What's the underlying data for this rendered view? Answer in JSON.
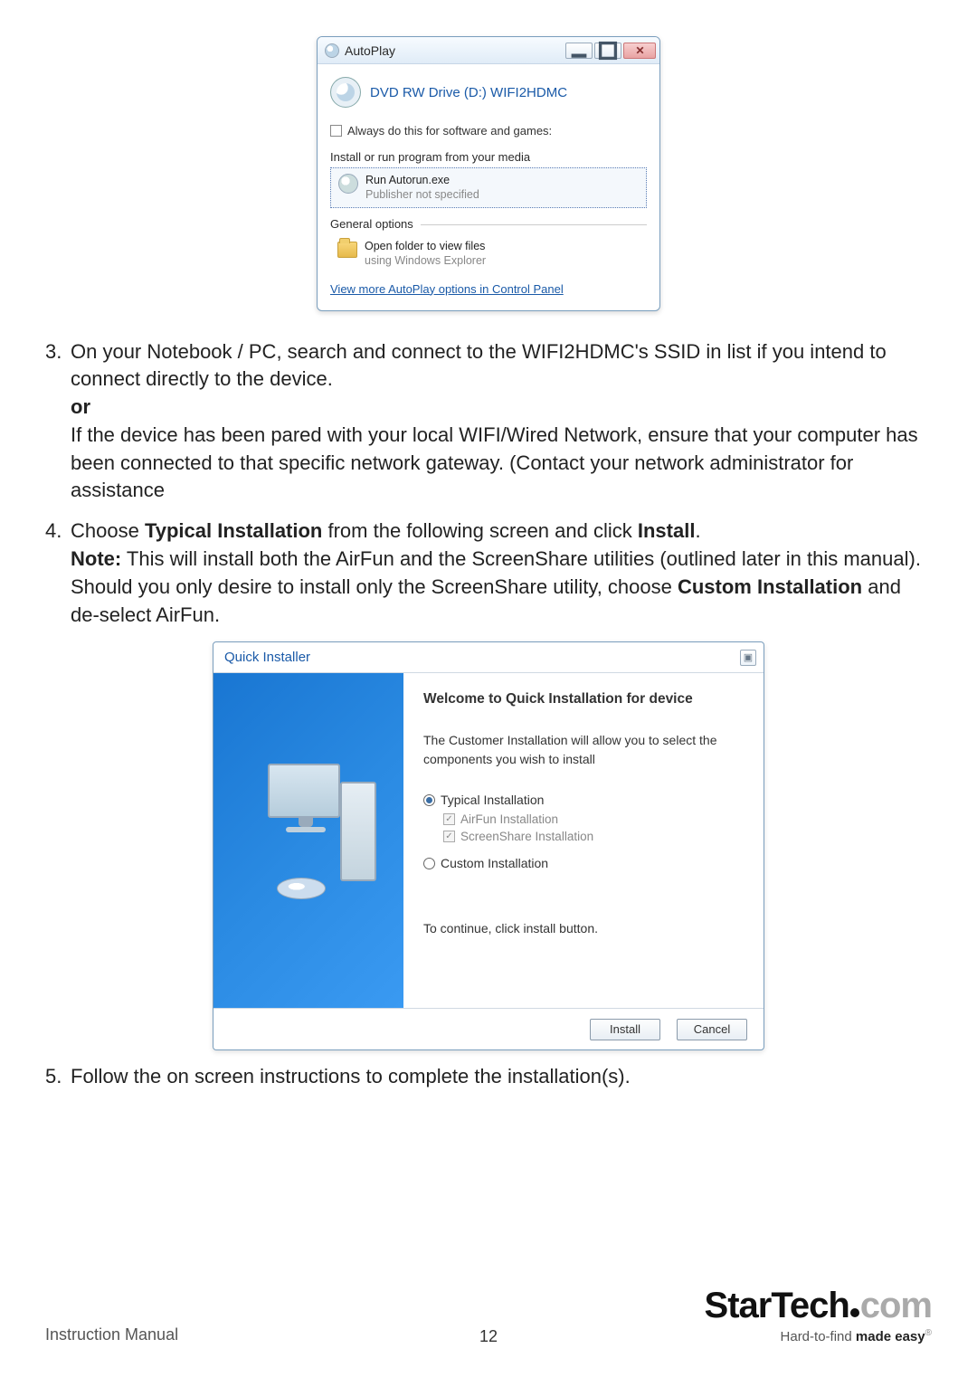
{
  "autoplay": {
    "title": "AutoPlay",
    "drive_label": "DVD RW Drive (D:) WIFI2HDMC",
    "always_text": "Always do this for software and games:",
    "install_group": "Install or run program from your media",
    "run_label": "Run Autorun.exe",
    "run_sub": "Publisher not specified",
    "general_group": "General options",
    "open_label": "Open folder to view files",
    "open_sub": "using Windows Explorer",
    "more_link": "View more AutoPlay options in Control Panel"
  },
  "steps": {
    "s3_num": "3.",
    "s3a": "On your Notebook / PC, search and connect to the WIFI2HDMC's SSID in list if you intend to connect directly to the device.",
    "s3_or": "or",
    "s3b": "If the device has been pared with your local WIFI/Wired Network, ensure that your computer has been connected to that specific network gateway. (Contact your network administrator for assistance",
    "s4_num": "4.",
    "s4a_pre": "Choose ",
    "s4a_b1": "Typical Installation",
    "s4a_mid": " from the following screen and click ",
    "s4a_b2": "Install",
    "s4a_post": ".",
    "s4_note_b": "Note:",
    "s4_note": " This will install both the AirFun and the ScreenShare utilities (outlined later in this manual). Should you only desire to install only the ScreenShare utility, choose ",
    "s4_note_b2": "Custom Installation",
    "s4_note_post": " and de-select AirFun.",
    "s5_num": "5.",
    "s5": "Follow the on screen instructions to complete the installation(s)."
  },
  "installer": {
    "title": "Quick Installer",
    "welcome": "Welcome to Quick Installation for device",
    "desc": "The Customer Installation will allow you to select the components you wish to install",
    "opt_typical": "Typical Installation",
    "sub_airfun": "AirFun Installation",
    "sub_screen": "ScreenShare Installation",
    "opt_custom": "Custom Installation",
    "continue": "To continue, click install button.",
    "btn_install": "Install",
    "btn_cancel": "Cancel"
  },
  "footer": {
    "left": "Instruction Manual",
    "page": "12",
    "logo_a": "StarTech",
    "logo_b": "com",
    "tag_a": "Hard-to-find ",
    "tag_b": "made easy",
    "reg": "®"
  }
}
